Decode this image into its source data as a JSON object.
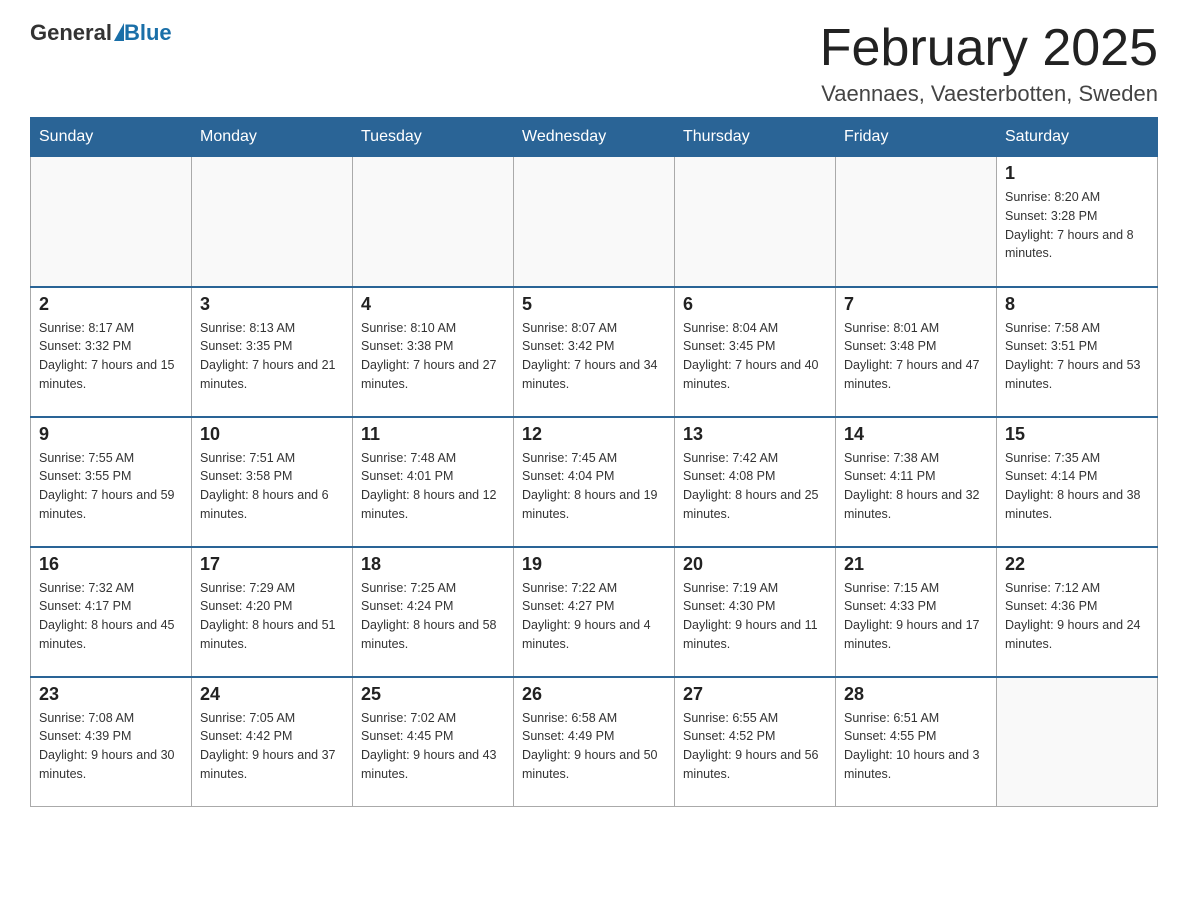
{
  "header": {
    "logo_general": "General",
    "logo_blue": "Blue",
    "month_title": "February 2025",
    "location": "Vaennaes, Vaesterbotten, Sweden"
  },
  "weekdays": [
    "Sunday",
    "Monday",
    "Tuesday",
    "Wednesday",
    "Thursday",
    "Friday",
    "Saturday"
  ],
  "weeks": [
    [
      {
        "day": "",
        "info": ""
      },
      {
        "day": "",
        "info": ""
      },
      {
        "day": "",
        "info": ""
      },
      {
        "day": "",
        "info": ""
      },
      {
        "day": "",
        "info": ""
      },
      {
        "day": "",
        "info": ""
      },
      {
        "day": "1",
        "info": "Sunrise: 8:20 AM\nSunset: 3:28 PM\nDaylight: 7 hours and 8 minutes."
      }
    ],
    [
      {
        "day": "2",
        "info": "Sunrise: 8:17 AM\nSunset: 3:32 PM\nDaylight: 7 hours and 15 minutes."
      },
      {
        "day": "3",
        "info": "Sunrise: 8:13 AM\nSunset: 3:35 PM\nDaylight: 7 hours and 21 minutes."
      },
      {
        "day": "4",
        "info": "Sunrise: 8:10 AM\nSunset: 3:38 PM\nDaylight: 7 hours and 27 minutes."
      },
      {
        "day": "5",
        "info": "Sunrise: 8:07 AM\nSunset: 3:42 PM\nDaylight: 7 hours and 34 minutes."
      },
      {
        "day": "6",
        "info": "Sunrise: 8:04 AM\nSunset: 3:45 PM\nDaylight: 7 hours and 40 minutes."
      },
      {
        "day": "7",
        "info": "Sunrise: 8:01 AM\nSunset: 3:48 PM\nDaylight: 7 hours and 47 minutes."
      },
      {
        "day": "8",
        "info": "Sunrise: 7:58 AM\nSunset: 3:51 PM\nDaylight: 7 hours and 53 minutes."
      }
    ],
    [
      {
        "day": "9",
        "info": "Sunrise: 7:55 AM\nSunset: 3:55 PM\nDaylight: 7 hours and 59 minutes."
      },
      {
        "day": "10",
        "info": "Sunrise: 7:51 AM\nSunset: 3:58 PM\nDaylight: 8 hours and 6 minutes."
      },
      {
        "day": "11",
        "info": "Sunrise: 7:48 AM\nSunset: 4:01 PM\nDaylight: 8 hours and 12 minutes."
      },
      {
        "day": "12",
        "info": "Sunrise: 7:45 AM\nSunset: 4:04 PM\nDaylight: 8 hours and 19 minutes."
      },
      {
        "day": "13",
        "info": "Sunrise: 7:42 AM\nSunset: 4:08 PM\nDaylight: 8 hours and 25 minutes."
      },
      {
        "day": "14",
        "info": "Sunrise: 7:38 AM\nSunset: 4:11 PM\nDaylight: 8 hours and 32 minutes."
      },
      {
        "day": "15",
        "info": "Sunrise: 7:35 AM\nSunset: 4:14 PM\nDaylight: 8 hours and 38 minutes."
      }
    ],
    [
      {
        "day": "16",
        "info": "Sunrise: 7:32 AM\nSunset: 4:17 PM\nDaylight: 8 hours and 45 minutes."
      },
      {
        "day": "17",
        "info": "Sunrise: 7:29 AM\nSunset: 4:20 PM\nDaylight: 8 hours and 51 minutes."
      },
      {
        "day": "18",
        "info": "Sunrise: 7:25 AM\nSunset: 4:24 PM\nDaylight: 8 hours and 58 minutes."
      },
      {
        "day": "19",
        "info": "Sunrise: 7:22 AM\nSunset: 4:27 PM\nDaylight: 9 hours and 4 minutes."
      },
      {
        "day": "20",
        "info": "Sunrise: 7:19 AM\nSunset: 4:30 PM\nDaylight: 9 hours and 11 minutes."
      },
      {
        "day": "21",
        "info": "Sunrise: 7:15 AM\nSunset: 4:33 PM\nDaylight: 9 hours and 17 minutes."
      },
      {
        "day": "22",
        "info": "Sunrise: 7:12 AM\nSunset: 4:36 PM\nDaylight: 9 hours and 24 minutes."
      }
    ],
    [
      {
        "day": "23",
        "info": "Sunrise: 7:08 AM\nSunset: 4:39 PM\nDaylight: 9 hours and 30 minutes."
      },
      {
        "day": "24",
        "info": "Sunrise: 7:05 AM\nSunset: 4:42 PM\nDaylight: 9 hours and 37 minutes."
      },
      {
        "day": "25",
        "info": "Sunrise: 7:02 AM\nSunset: 4:45 PM\nDaylight: 9 hours and 43 minutes."
      },
      {
        "day": "26",
        "info": "Sunrise: 6:58 AM\nSunset: 4:49 PM\nDaylight: 9 hours and 50 minutes."
      },
      {
        "day": "27",
        "info": "Sunrise: 6:55 AM\nSunset: 4:52 PM\nDaylight: 9 hours and 56 minutes."
      },
      {
        "day": "28",
        "info": "Sunrise: 6:51 AM\nSunset: 4:55 PM\nDaylight: 10 hours and 3 minutes."
      },
      {
        "day": "",
        "info": ""
      }
    ]
  ]
}
